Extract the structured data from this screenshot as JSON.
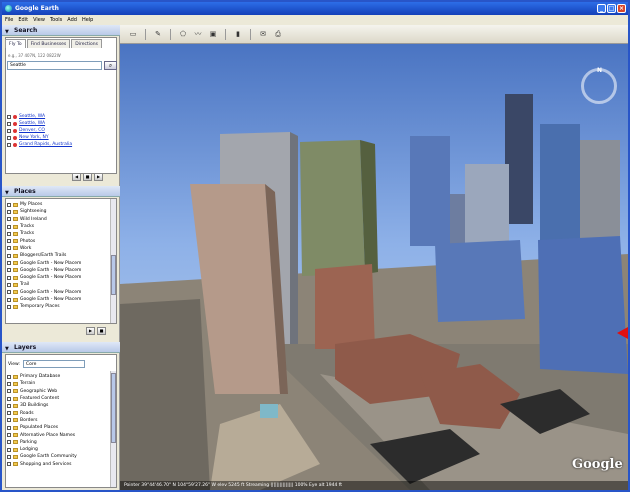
{
  "app": {
    "title": "Google Earth"
  },
  "menu": [
    "File",
    "Edit",
    "View",
    "Tools",
    "Add",
    "Help"
  ],
  "search": {
    "header": "Search",
    "tabs": [
      "Fly To",
      "Find Businesses",
      "Directions"
    ],
    "hint": "e.g., 37 407N, 122 0822W",
    "value": "Seattle",
    "results": [
      "Seattle, WA",
      "Seattle, WA",
      "Denver, CO",
      "New York, NY",
      "Grand Rapids, Australia"
    ]
  },
  "places": {
    "header": "Places",
    "items": [
      "My Places",
      "Sightseeing",
      "Wild Ireland",
      "Tracks",
      "Tracks",
      "Photos",
      "Work",
      "Bloggers/Earth Trails",
      "Google Earth - New Placem",
      "Google Earth - New Placem",
      "Google Earth - New Placem",
      "Trail",
      "Google Earth - New Placem",
      "Google Earth - New Placem",
      "Temporary Places"
    ]
  },
  "layers": {
    "header": "Layers",
    "view_label": "View:",
    "view_value": "Core",
    "items": [
      "Primary Database",
      "Terrain",
      "Geographic Web",
      "Featured Content",
      "3D Buildings",
      "Roads",
      "Borders",
      "Populated Places",
      "Alternative Place Names",
      "Parking",
      "Lodging",
      "Google Earth Community",
      "Shopping and Services"
    ]
  },
  "toolbar": {
    "buttons": [
      "sidebar",
      "placemark",
      "polygon",
      "path",
      "overlay",
      "measure",
      "email",
      "print"
    ]
  },
  "viewport": {
    "compass_n": "N",
    "logo": "Google",
    "status": "Pointer 39°44'46.70\" N 104°59'27.26\" W  elev 5245 ft  Streaming ||||||||||||||| 100%  Eye alt 1944 ft"
  },
  "colors": {
    "accent": "#2d6ee8",
    "arrow": "#e01010",
    "sky_top": "#4a74c2"
  }
}
